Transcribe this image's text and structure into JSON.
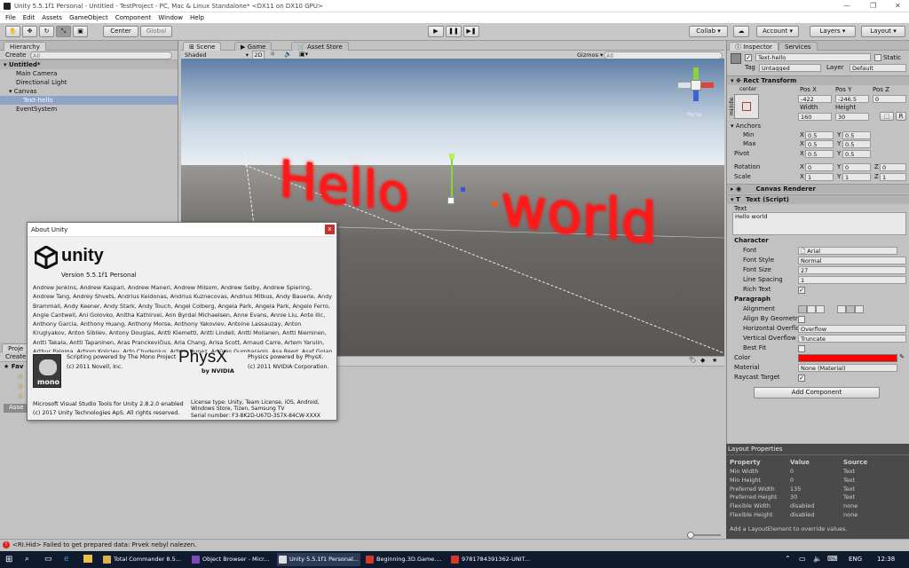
{
  "window": {
    "title": "Unity 5.5.1f1 Personal - Untitled - TestProject - PC, Mac & Linux Standalone* <DX11 on DX10 GPU>"
  },
  "menu": [
    "File",
    "Edit",
    "Assets",
    "GameObject",
    "Component",
    "Window",
    "Help"
  ],
  "toolbar": {
    "pivot": "Center",
    "space": "Global",
    "collab": "Collab",
    "account": "Account",
    "layers": "Layers",
    "layout": "Layout"
  },
  "hierarchy": {
    "tab": "Hierarchy",
    "create": "Create",
    "search_placeholder": "All",
    "scene": "Untitled*",
    "items": [
      "Main Camera",
      "Directional Light",
      "Canvas",
      "Text-hello",
      "EventSystem"
    ]
  },
  "scene": {
    "tabs": [
      "Scene",
      "Game",
      "Asset Store"
    ],
    "shading": "Shaded",
    "mode": "2D",
    "gizmos": "Gizmos",
    "search_placeholder": "All",
    "text_hello": "Hello",
    "text_world": "world",
    "persp": "Persp"
  },
  "about": {
    "title": "About Unity",
    "logo": "unity",
    "version": "Version 5.5.1f1 Personal",
    "credits": "Andrew Jenkins, Andrew Kaspari, Andrew Maneri, Andrew Milsom, Andrew Selby, Andrew Spiering, Andrew Tang, Andrey Shvets, Andrius Keidonas, Andrius Kuznecovas, Andrius Mitkus, Andy Bauerle, Andy Brammall, Andy Keener, Andy Stark, Andy Touch, Angel Colberg, Angela Park, Angela Park, Angelo Ferro, Angie Cantwell, Ani Golovko, Anitha Kathirvel, Ann Byrdal Michaelsen, Anne Evans, Annie Liu, Ante Ilic, Anthony Garcia, Anthony Huang, Anthony Morse, Anthony Yakovlev, Antoine Lassauzay, Anton Kruglyakov, Anton Sibilev, Antony Douglas, Antti Klemetti, Antti Lindell, Antti Moilanen, Antti Nieminen, Antti Takala, Antti Tapaninen, Aras Pranckevičius, Aria Chang, Arisa Scott, Arnaud Carre, Artem Yarulin, Arthur Paloma, Artiom Koliclev, Arto Chydenius, Arturo Nunez, Artūras Gumbaragis, Asa Reed, Asaf Golan, Ashley Alicea, Ashley Yu, Ashu Rawat",
    "mono_label": "mono",
    "mono_credit": "Scripting powered by The Mono Project",
    "mono_copyright": "(c) 2011 Novell, Inc.",
    "physx_logo": "PhysX",
    "physx_by": "by NVIDIA",
    "physx_credit": "Physics powered by PhysX.",
    "physx_copyright": "(c) 2011 NVIDIA Corporation.",
    "vstools": "Microsoft Visual Studio Tools for Unity 2.8.2.0 enabled",
    "copyright": "(c) 2017 Unity Technologies ApS. All rights reserved.",
    "license": "License type: Unity, Team License, iOS, Android, Windows Store, Tizen, Samsung TV",
    "serial": "Serial number: F3-8K2D-U67D-3S7X-84CW-XXXX"
  },
  "project": {
    "tab": "Proje",
    "create": "Create",
    "favorites": "Fav",
    "assets": "Asse"
  },
  "inspector": {
    "tabs": [
      "Inspector",
      "Services"
    ],
    "name": "Text-hello",
    "static": "Static",
    "tag_label": "Tag",
    "tag": "Untagged",
    "layer_label": "Layer",
    "layer": "Default",
    "rect_transform": "Rect Transform",
    "anchor_h": "center",
    "anchor_v": "middle",
    "pos_x_label": "Pos X",
    "pos_y_label": "Pos Y",
    "pos_z_label": "Pos Z",
    "pos_x": "-422",
    "pos_y": "-246.5",
    "pos_z": "0",
    "width_label": "Width",
    "height_label": "Height",
    "width": "160",
    "height": "30",
    "r_btn": "R",
    "anchors": "Anchors",
    "min": "Min",
    "max": "Max",
    "pivot": "Pivot",
    "min_x": "0.5",
    "min_y": "0.5",
    "max_x": "0.5",
    "max_y": "0.5",
    "pivot_x": "0.5",
    "pivot_y": "0.5",
    "rotation": "Rotation",
    "rot_x": "0",
    "rot_y": "0",
    "rot_z": "0",
    "scale": "Scale",
    "scale_x": "1",
    "scale_y": "1",
    "scale_z": "1",
    "x": "X",
    "y": "Y",
    "z": "Z",
    "canvas_renderer": "Canvas Renderer",
    "text_script": "Text (Script)",
    "text_label": "Text",
    "text_value": "Hello world",
    "character": "Character",
    "font_label": "Font",
    "font": "Arial",
    "font_style_label": "Font Style",
    "font_style": "Normal",
    "font_size_label": "Font Size",
    "font_size": "27",
    "line_spacing_label": "Line Spacing",
    "line_spacing": "1",
    "rich_text_label": "Rich Text",
    "paragraph": "Paragraph",
    "alignment_label": "Alignment",
    "align_geometry_label": "Align By Geometr",
    "horiz_overflow_label": "Horizontal Overflo",
    "horiz_overflow": "Overflow",
    "vert_overflow_label": "Vertical Overflow",
    "vert_overflow": "Truncate",
    "best_fit_label": "Best Fit",
    "color_label": "Color",
    "color": "#ff0000",
    "material_label": "Material",
    "material": "None (Material)",
    "raycast_label": "Raycast Target",
    "add_component": "Add Component"
  },
  "layout_props": {
    "title": "Layout Properties",
    "headers": [
      "Property",
      "Value",
      "Source"
    ],
    "rows": [
      [
        "Min Width",
        "0",
        "Text"
      ],
      [
        "Min Height",
        "0",
        "Text"
      ],
      [
        "Preferred Width",
        "135",
        "Text"
      ],
      [
        "Preferred Height",
        "30",
        "Text"
      ],
      [
        "Flexible Width",
        "disabled",
        "none"
      ],
      [
        "Flexible Height",
        "disabled",
        "none"
      ]
    ],
    "hint": "Add a LayoutElement to override values."
  },
  "status": {
    "message": "<RI.Hid> Failed to get prepared data: Prvek nebyl nalezen."
  },
  "taskbar": {
    "apps": [
      "Total Commander 8.5...",
      "Object Browser - Micr...",
      "Unity 5.5.1f1 Personal...",
      "Beginning.3D.Game....",
      "9781784391362-UNIT..."
    ],
    "lang": "ENG",
    "time": "12:38"
  }
}
